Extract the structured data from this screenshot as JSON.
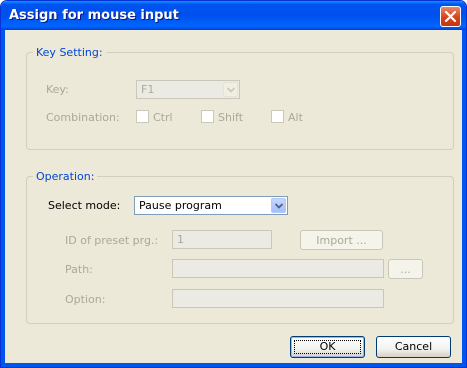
{
  "window": {
    "title": "Assign for mouse input"
  },
  "key_setting": {
    "legend": "Key Setting:",
    "key_label": "Key:",
    "key_value": "F1",
    "combination_label": "Combination:",
    "ctrl_label": "Ctrl",
    "shift_label": "Shift",
    "alt_label": "Alt"
  },
  "operation": {
    "legend": "Operation:",
    "mode_label": "Select mode:",
    "mode_value": "Pause program",
    "preset_label": "ID of preset prg.:",
    "preset_value": "1",
    "import_label": "Import ...",
    "path_label": "Path:",
    "path_value": "",
    "browse_label": "...",
    "option_label": "Option:",
    "option_value": ""
  },
  "buttons": {
    "ok": "OK",
    "cancel": "Cancel"
  },
  "colors": {
    "titlebar": "#0054e3",
    "legend_text": "#0046d5",
    "dialog_bg": "#ece9d8",
    "close_button": "#d4431d"
  },
  "icons": {
    "close": "close-icon",
    "dropdown": "chevron-down-icon"
  }
}
